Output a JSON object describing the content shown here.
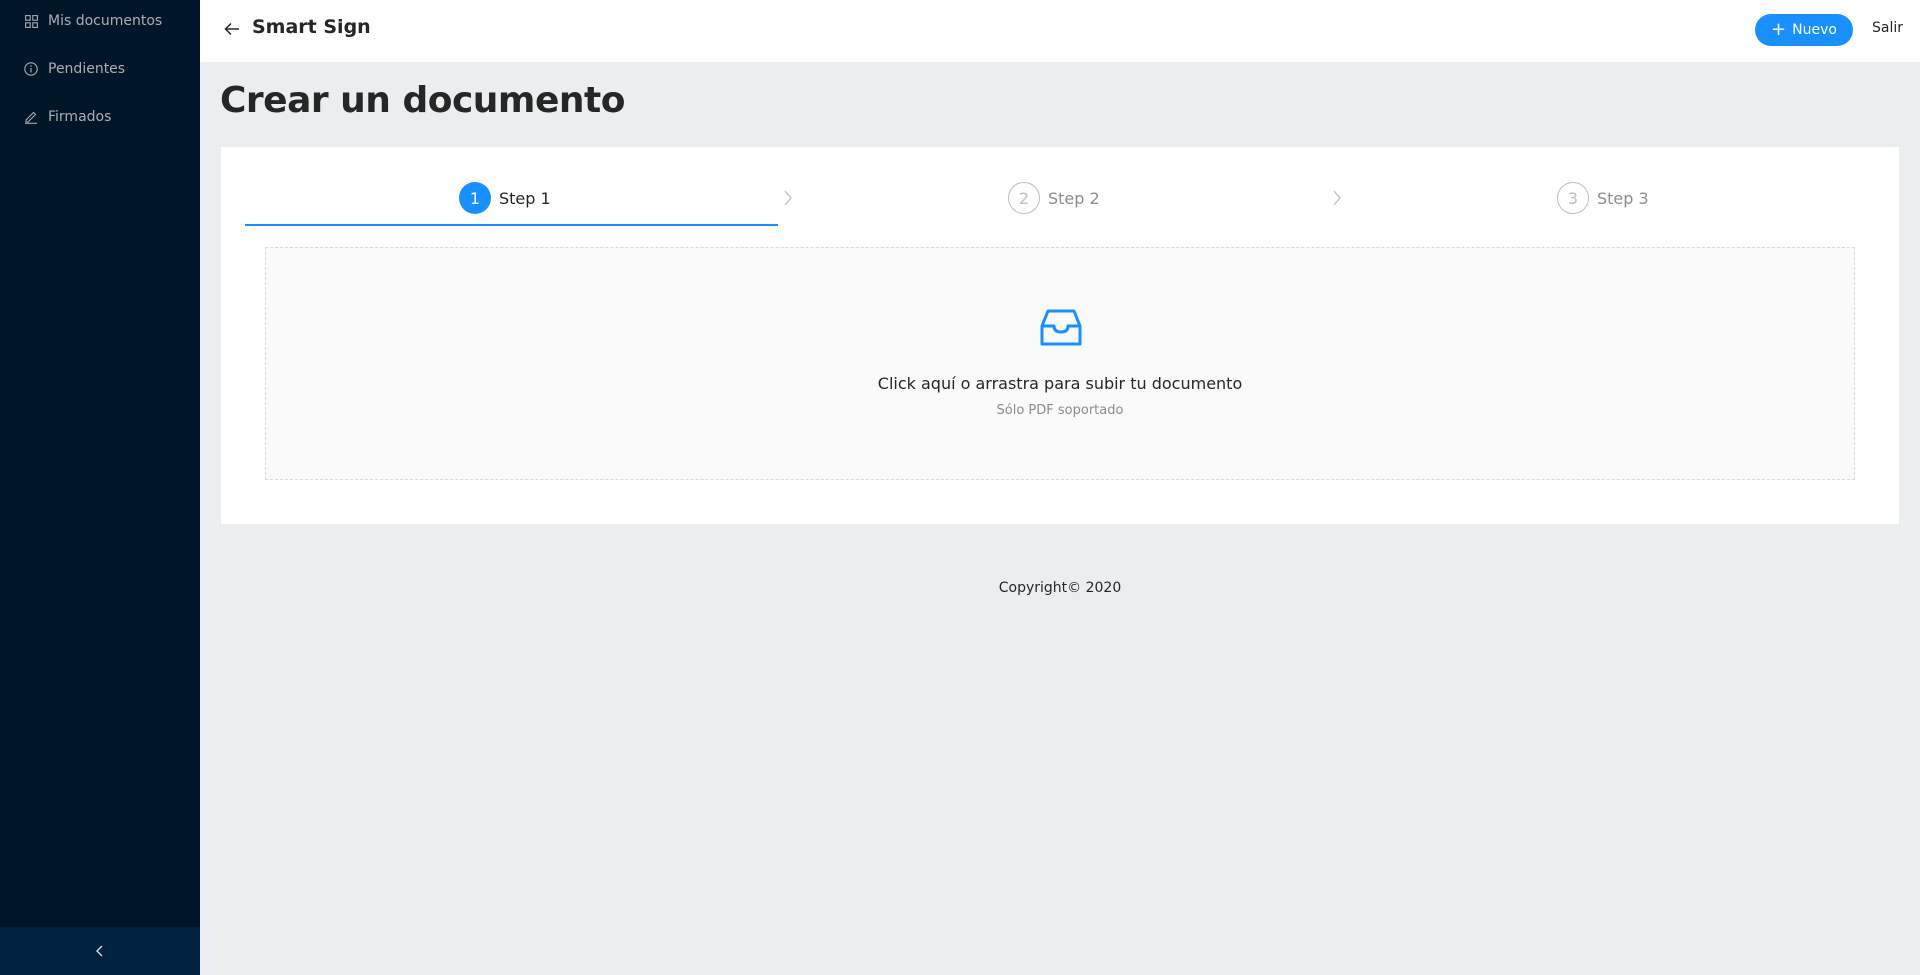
{
  "sidebar": {
    "items": [
      {
        "label": "Mis documentos",
        "icon": "dashboard-icon"
      },
      {
        "label": "Pendientes",
        "icon": "info-circle-icon"
      },
      {
        "label": "Firmados",
        "icon": "edit-icon"
      }
    ],
    "collapse_icon": "chevron-left-icon"
  },
  "header": {
    "title": "Smart Sign",
    "new_button": "Nuevo",
    "logout": "Salir"
  },
  "page": {
    "title": "Crear un documento"
  },
  "steps": [
    {
      "number": "1",
      "label": "Step 1",
      "status": "active"
    },
    {
      "number": "2",
      "label": "Step 2",
      "status": "wait"
    },
    {
      "number": "3",
      "label": "Step 3",
      "status": "wait"
    }
  ],
  "upload": {
    "icon": "inbox-icon",
    "text": "Click aquí o arrastra para subir tu documento",
    "hint": "Sólo PDF soportado"
  },
  "footer": {
    "copyright": "Copyright© 2020"
  },
  "colors": {
    "primary": "#1890ff",
    "sidebar_bg": "#001528",
    "page_bg": "#ebeef1"
  }
}
